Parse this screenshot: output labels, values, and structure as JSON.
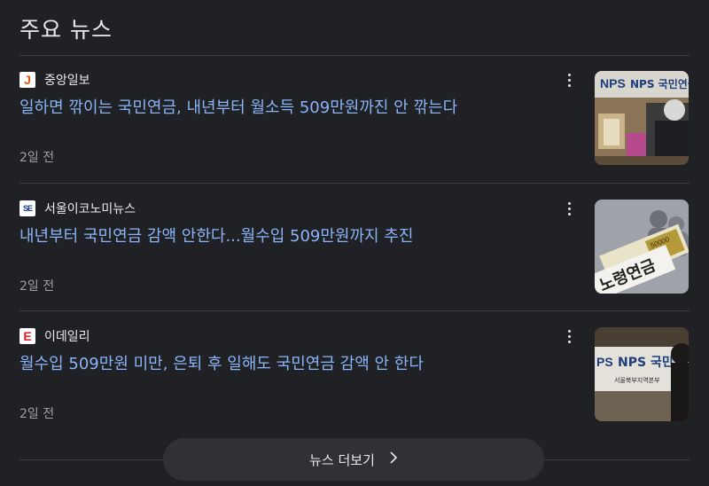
{
  "section": {
    "title": "주요 뉴스"
  },
  "articles": [
    {
      "source": "중앙일보",
      "favicon": "J",
      "headline": "일하면 깎이는 국민연금, 내년부터 월소득 509만원까진 안 깎는다",
      "time": "2일 전",
      "thumb_text": "NPS 국민연금"
    },
    {
      "source": "서울이코노미뉴스",
      "favicon": "SE",
      "headline": "내년부터 국민연금 감액 안한다...월수입 509만원까지 추진",
      "time": "2일 전",
      "thumb_text": "노령연금"
    },
    {
      "source": "이데일리",
      "favicon": "E",
      "headline": "월수입 509만원 미만, 은퇴 후 일해도 국민연금 감액 안 한다",
      "time": "2일 전",
      "thumb_text": "NPS 국민연금",
      "thumb_subtext": "서울북부지역본부"
    }
  ],
  "more_news": {
    "label": "뉴스 더보기",
    "icon": "chevron-right-icon"
  },
  "colors": {
    "background": "#202124",
    "link": "#8ab4f8",
    "muted": "#9aa0a6",
    "divider": "#3c4043"
  }
}
